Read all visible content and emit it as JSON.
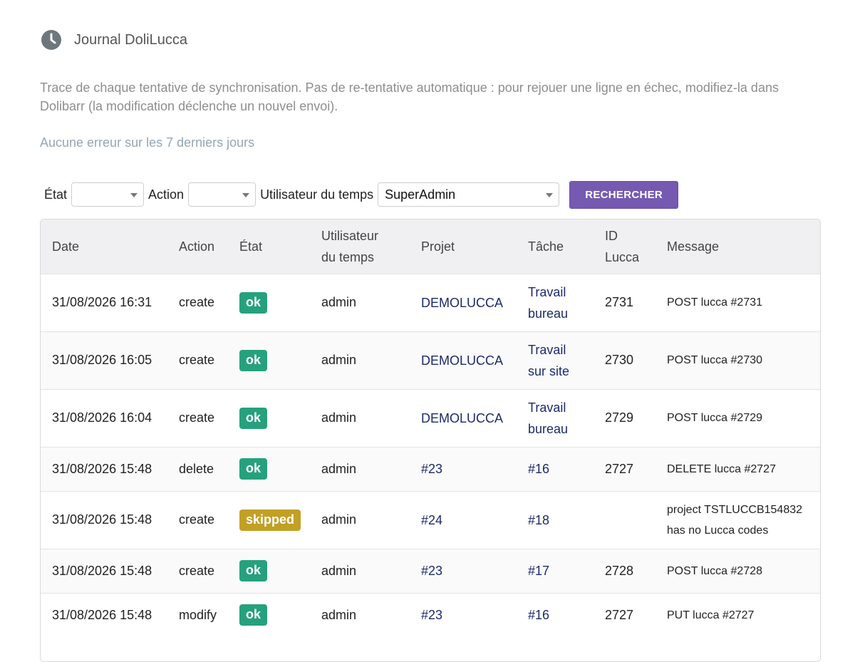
{
  "header": {
    "title": "Journal DoliLucca",
    "icon": "clock-icon"
  },
  "description": "Trace de chaque tentative de synchronisation. Pas de re-tentative automatique : pour rejouer une ligne en échec, modifiez-la dans Dolibarr (la modification déclenche un nouvel envoi).",
  "status_notice": "Aucune erreur sur les 7 derniers jours",
  "filters": {
    "state_label": "État",
    "state_value": "",
    "action_label": "Action",
    "action_value": "",
    "user_label": "Utilisateur du temps",
    "user_value": "SuperAdmin",
    "search_button": "RECHERCHER"
  },
  "colors": {
    "accent": "#7659b1",
    "ok": "#26a17d",
    "skipped": "#c2a025",
    "link": "#1d2a6a"
  },
  "table": {
    "headers": {
      "date": "Date",
      "action": "Action",
      "state": "État",
      "user_line1": "Utilisateur",
      "user_line2": "du temps",
      "project": "Projet",
      "task": "Tâche",
      "id_line1": "ID",
      "id_line2": "Lucca",
      "message": "Message"
    },
    "rows": [
      {
        "date": "31/08/2026 16:31",
        "action": "create",
        "state": "ok",
        "user": "admin",
        "project": "DEMOLUCCA",
        "task1": "Travail",
        "task2": "bureau",
        "lucca_id": "2731",
        "msg1": "POST lucca #2731",
        "msg2": ""
      },
      {
        "date": "31/08/2026 16:05",
        "action": "create",
        "state": "ok",
        "user": "admin",
        "project": "DEMOLUCCA",
        "task1": "Travail",
        "task2": "sur site",
        "lucca_id": "2730",
        "msg1": "POST lucca #2730",
        "msg2": ""
      },
      {
        "date": "31/08/2026 16:04",
        "action": "create",
        "state": "ok",
        "user": "admin",
        "project": "DEMOLUCCA",
        "task1": "Travail",
        "task2": "bureau",
        "lucca_id": "2729",
        "msg1": "POST lucca #2729",
        "msg2": ""
      },
      {
        "date": "31/08/2026 15:48",
        "action": "delete",
        "state": "ok",
        "user": "admin",
        "project": "#23",
        "task1": "#16",
        "task2": "",
        "lucca_id": "2727",
        "msg1": "DELETE lucca #2727",
        "msg2": ""
      },
      {
        "date": "31/08/2026 15:48",
        "action": "create",
        "state": "skipped",
        "user": "admin",
        "project": "#24",
        "task1": "#18",
        "task2": "",
        "lucca_id": "",
        "msg1": "project TSTLUCCB154832",
        "msg2": "has no Lucca codes"
      },
      {
        "date": "31/08/2026 15:48",
        "action": "create",
        "state": "ok",
        "user": "admin",
        "project": "#23",
        "task1": "#17",
        "task2": "",
        "lucca_id": "2728",
        "msg1": "POST lucca #2728",
        "msg2": ""
      },
      {
        "date": "31/08/2026 15:48",
        "action": "modify",
        "state": "ok",
        "user": "admin",
        "project": "#23",
        "task1": "#16",
        "task2": "",
        "lucca_id": "2727",
        "msg1": "PUT lucca #2727",
        "msg2": ""
      }
    ]
  }
}
